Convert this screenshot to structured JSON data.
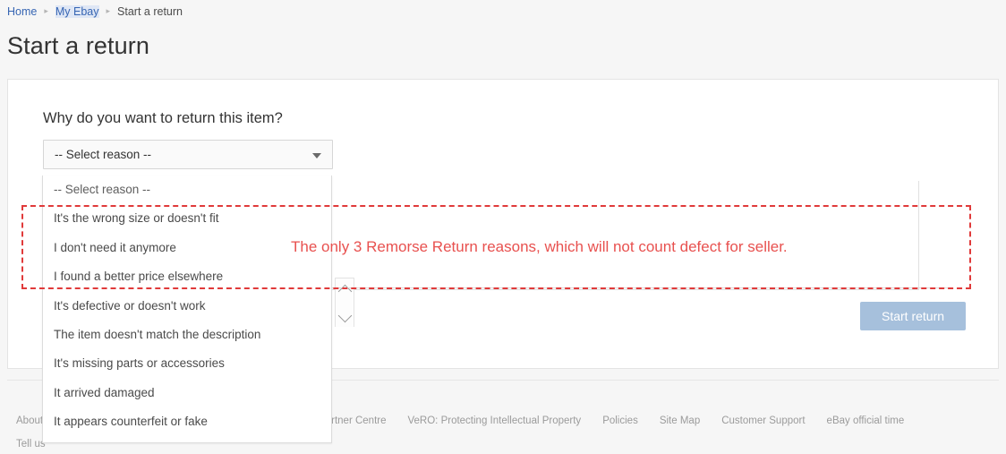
{
  "breadcrumb": {
    "items": [
      {
        "label": "Home",
        "type": "link"
      },
      {
        "label": "My Ebay",
        "type": "link-active"
      },
      {
        "label": "Start a return",
        "type": "current"
      }
    ],
    "separator": "▸"
  },
  "page": {
    "title": "Start a return"
  },
  "form": {
    "question": "Why do you want to return this item?",
    "select": {
      "value": "-- Select reason --",
      "options": [
        "-- Select reason --",
        "It's the wrong size or doesn't fit",
        "I don't need it anymore",
        "I found a better price elsewhere",
        "It's defective or doesn't work",
        "The item doesn't match the description",
        "It's missing parts or accessories",
        "It arrived damaged",
        "It appears counterfeit or fake"
      ]
    },
    "submit_label": "Start return"
  },
  "annotation": {
    "text": "The only 3 Remorse Return reasons, which will not count defect for seller.",
    "color": "#e8514f"
  },
  "footer": {
    "links": [
      "About",
      "Tell us",
      "Partner Centre",
      "VeRO: Protecting Intellectual Property",
      "Policies",
      "Site Map",
      "Customer Support",
      "eBay official time"
    ]
  }
}
